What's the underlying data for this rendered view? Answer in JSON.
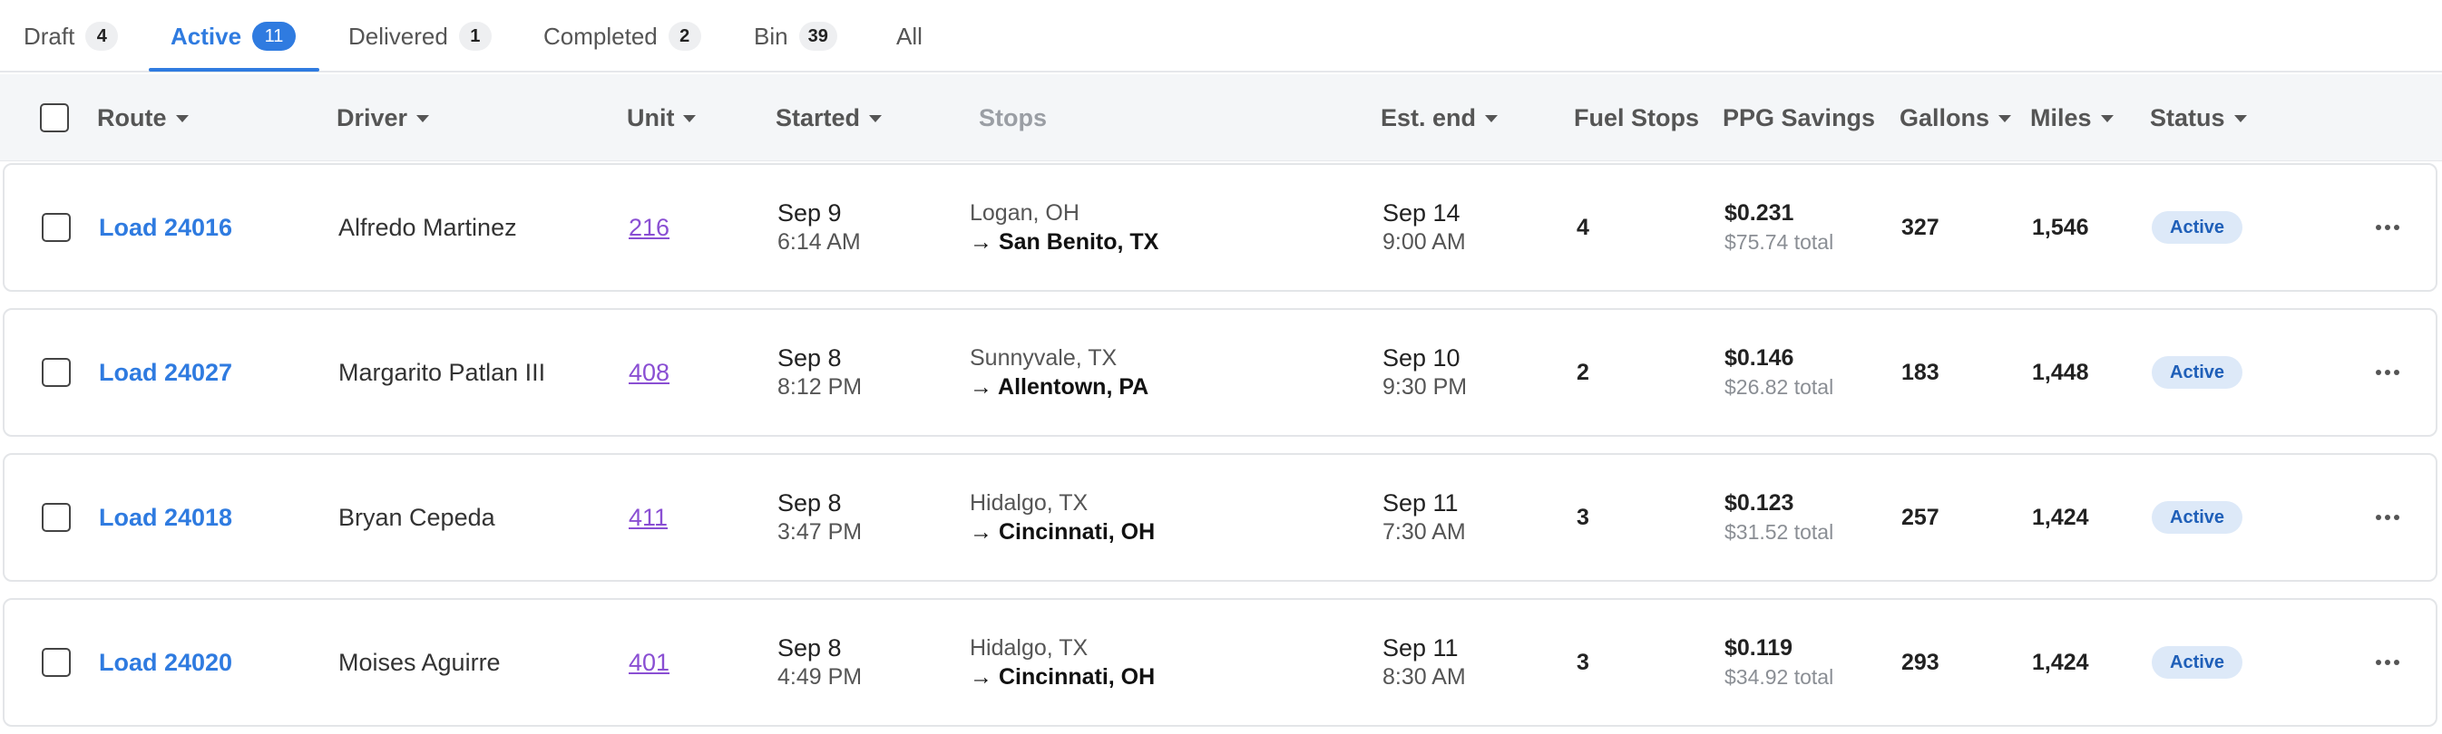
{
  "tabs": [
    {
      "label": "Draft",
      "count": "4"
    },
    {
      "label": "Active",
      "count": "11"
    },
    {
      "label": "Delivered",
      "count": "1"
    },
    {
      "label": "Completed",
      "count": "2"
    },
    {
      "label": "Bin",
      "count": "39"
    },
    {
      "label": "All",
      "count": ""
    }
  ],
  "active_tab": "Active",
  "header": {
    "route": "Route",
    "driver": "Driver",
    "unit": "Unit",
    "started": "Started",
    "stops": "Stops",
    "est_end": "Est. end",
    "fuel_stops": "Fuel Stops",
    "ppg_savings": "PPG Savings",
    "gallons": "Gallons",
    "miles": "Miles",
    "status": "Status"
  },
  "rows": [
    {
      "route": "Load 24016",
      "driver": "Alfredo Martinez",
      "unit": "216",
      "started_date": "Sep 9",
      "started_time": "6:14 AM",
      "origin": "Logan, OH",
      "destination": "→ San Benito, TX",
      "end_date": "Sep 14",
      "end_time": "9:00 AM",
      "fuel_stops": "4",
      "ppg": "$0.231",
      "ppg_total": "$75.74 total",
      "gallons": "327",
      "miles": "1,546",
      "status": "Active"
    },
    {
      "route": "Load 24027",
      "driver": "Margarito Patlan III",
      "unit": "408",
      "started_date": "Sep 8",
      "started_time": "8:12 PM",
      "origin": "Sunnyvale, TX",
      "destination": "→ Allentown, PA",
      "end_date": "Sep 10",
      "end_time": "9:30 PM",
      "fuel_stops": "2",
      "ppg": "$0.146",
      "ppg_total": "$26.82 total",
      "gallons": "183",
      "miles": "1,448",
      "status": "Active"
    },
    {
      "route": "Load 24018",
      "driver": "Bryan Cepeda",
      "unit": "411",
      "started_date": "Sep 8",
      "started_time": "3:47 PM",
      "origin": "Hidalgo, TX",
      "destination": "→ Cincinnati, OH",
      "end_date": "Sep 11",
      "end_time": "7:30 AM",
      "fuel_stops": "3",
      "ppg": "$0.123",
      "ppg_total": "$31.52 total",
      "gallons": "257",
      "miles": "1,424",
      "status": "Active"
    },
    {
      "route": "Load 24020",
      "driver": "Moises Aguirre",
      "unit": "401",
      "started_date": "Sep 8",
      "started_time": "4:49 PM",
      "origin": "Hidalgo, TX",
      "destination": "→ Cincinnati, OH",
      "end_date": "Sep 11",
      "end_time": "8:30 AM",
      "fuel_stops": "3",
      "ppg": "$0.119",
      "ppg_total": "$34.92 total",
      "gallons": "293",
      "miles": "1,424",
      "status": "Active"
    }
  ],
  "icons": {
    "sort": "caret-down-icon",
    "more": "more-horizontal-icon"
  },
  "colors": {
    "accent": "#2f7be0",
    "unit_link": "#8a4fd3",
    "status_bg": "#dde9f8",
    "status_text": "#1f5fb8"
  }
}
